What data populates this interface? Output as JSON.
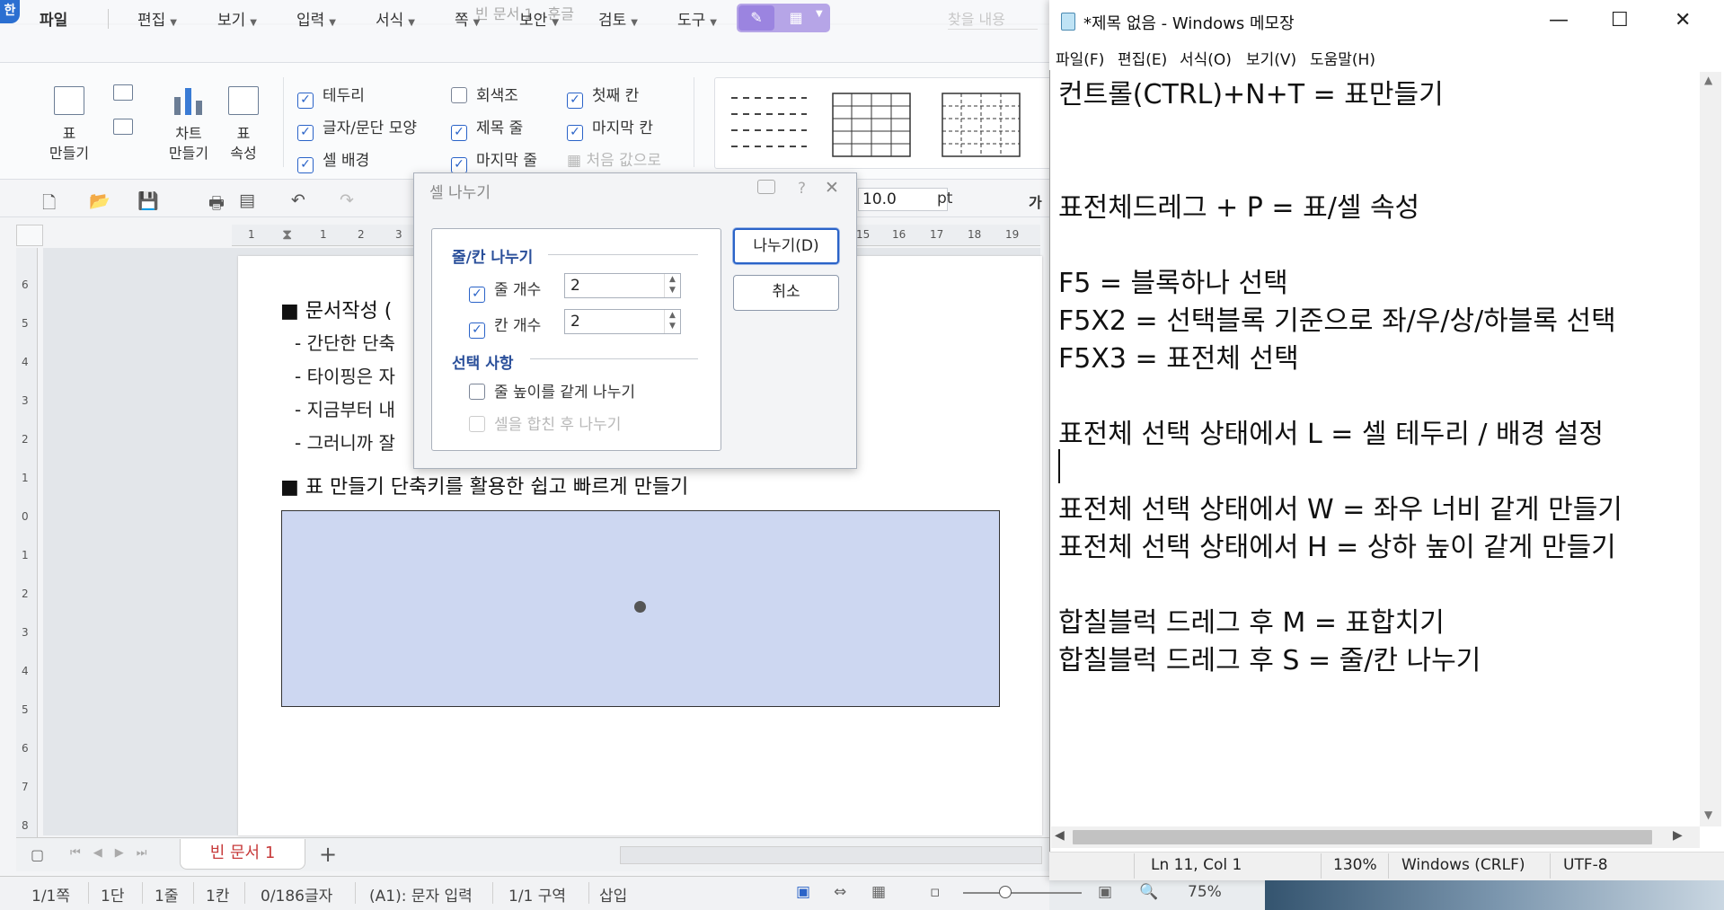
{
  "hwp": {
    "logo": "한",
    "title": "빈 문서 1 - 훈글",
    "menu": {
      "file": "파일",
      "tabs": [
        "편집",
        "보기",
        "입력",
        "서식",
        "쪽",
        "보안",
        "검토",
        "도구"
      ],
      "search_placeholder": "찾을 내용"
    },
    "ribbon": {
      "table_make": "표\n만들기",
      "chart_make": "차트\n만들기",
      "table_props": "표\n속성",
      "checks": [
        {
          "label": "테두리",
          "checked": true
        },
        {
          "label": "글자/문단 모양",
          "checked": true
        },
        {
          "label": "셀 배경",
          "checked": true
        },
        {
          "label": "회색조",
          "checked": false
        },
        {
          "label": "제목 줄",
          "checked": true
        },
        {
          "label": "마지막 줄",
          "checked": true
        },
        {
          "label": "첫째 칸",
          "checked": true
        },
        {
          "label": "마지막 칸",
          "checked": true
        }
      ],
      "reset_label": "처음 값으로"
    },
    "font_size": "10.0",
    "font_unit": "pt",
    "ruler_h": [
      "1",
      "1",
      "2",
      "3",
      "15",
      "16",
      "17",
      "18",
      "19"
    ],
    "ruler_v": [
      "6",
      "5",
      "4",
      "3",
      "2",
      "1",
      "0",
      "1",
      "2",
      "3",
      "4",
      "5",
      "6",
      "7",
      "8"
    ],
    "doc": {
      "heading1": "■  문서작성  (",
      "bullets": [
        "- 간단한  단축",
        "- 타이핑은  자",
        "- 지금부터  내",
        "- 그러니까  잘"
      ],
      "heading2": "■  표  만들기  단축키를  활용한  쉽고  빠르게  만들기"
    },
    "doc_tab": "빈 문서 1",
    "status": [
      "1/1쪽",
      "1단",
      "1줄",
      "1칸",
      "0/186글자",
      "(A1): 문자 입력",
      "1/1 구역",
      "삽입"
    ],
    "zoom": "75%"
  },
  "dialog": {
    "title": "셀 나누기",
    "group1_title": "줄/칸 나누기",
    "rows_label": "줄 개수",
    "rows_value": "2",
    "cols_label": "칸 개수",
    "cols_value": "2",
    "group2_title": "선택 사항",
    "opt1": "줄 높이를 같게 나누기",
    "opt2": "셀을 합친 후 나누기",
    "ok": "나누기(D)",
    "cancel": "취소"
  },
  "notepad": {
    "title": "*제목 없음 - Windows 메모장",
    "menu": [
      "파일(F)",
      "편집(E)",
      "서식(O)",
      "보기(V)",
      "도움말(H)"
    ],
    "lines": [
      "컨트롤(CTRL)+N+T = 표만들기",
      "",
      "",
      "표전체드레그 + P = 표/셀 속성",
      "",
      "F5 = 블록하나 선택",
      "F5X2 = 선택블록 기준으로 좌/우/상/하블록 선택",
      "F5X3 = 표전체 선택",
      "",
      "표전체 선택 상태에서 L = 셀 테두리 / 배경 설정",
      "",
      "표전체 선택 상태에서 W = 좌우 너비 같게 만들기",
      "표전체 선택 상태에서 H = 상하 높이 같게 만들기",
      "",
      "합칠블럭 드레그 후 M = 표합치기",
      "합칠블럭 드레그 후 S = 줄/칸 나누기"
    ],
    "status": {
      "position": "Ln 11, Col 1",
      "zoom": "130%",
      "line_ending": "Windows (CRLF)",
      "encoding": "UTF-8"
    }
  }
}
